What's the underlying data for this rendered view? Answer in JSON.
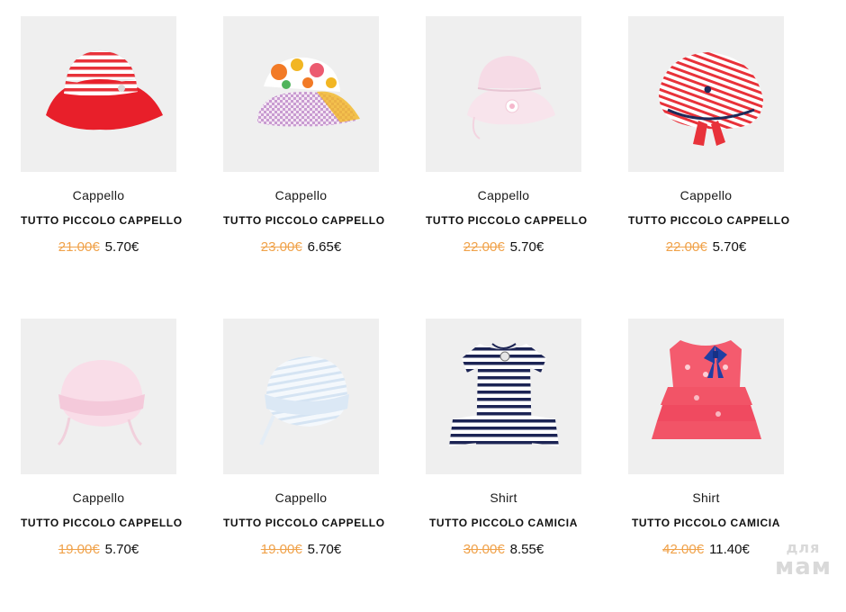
{
  "products": [
    {
      "category": "Cappello",
      "title": "TUTTO PICCOLO CAPPELLO",
      "old_price": "21.00€",
      "price": "5.70€",
      "image": "red-striped-bucket-hat"
    },
    {
      "category": "Cappello",
      "title": "TUTTO PICCOLO CAPPELLO",
      "old_price": "23.00€",
      "price": "6.65€",
      "image": "floral-gingham-bucket-hat"
    },
    {
      "category": "Cappello",
      "title": "TUTTO PICCOLO CAPPELLO",
      "old_price": "22.00€",
      "price": "5.70€",
      "image": "pink-bucket-hat"
    },
    {
      "category": "Cappello",
      "title": "TUTTO PICCOLO CAPPELLO",
      "old_price": "22.00€",
      "price": "5.70€",
      "image": "red-striped-sun-hat"
    },
    {
      "category": "Cappello",
      "title": "TUTTO PICCOLO CAPPELLO",
      "old_price": "19.00€",
      "price": "5.70€",
      "image": "pink-baby-bonnet"
    },
    {
      "category": "Cappello",
      "title": "TUTTO PICCOLO CAPPELLO",
      "old_price": "19.00€",
      "price": "5.70€",
      "image": "light-blue-baby-bonnet"
    },
    {
      "category": "Shirt",
      "title": "TUTTO PICCOLO CAMICIA",
      "old_price": "30.00€",
      "price": "8.55€",
      "image": "navy-striped-ruffle-top"
    },
    {
      "category": "Shirt",
      "title": "TUTTO PICCOLO CAMICIA",
      "old_price": "42.00€",
      "price": "11.40€",
      "image": "coral-ruffle-top-with-bow"
    }
  ],
  "watermark": {
    "line1": "для",
    "line2": "мам"
  },
  "colors": {
    "old_price": "#f0a24a",
    "thumb_bg": "#efefef"
  }
}
